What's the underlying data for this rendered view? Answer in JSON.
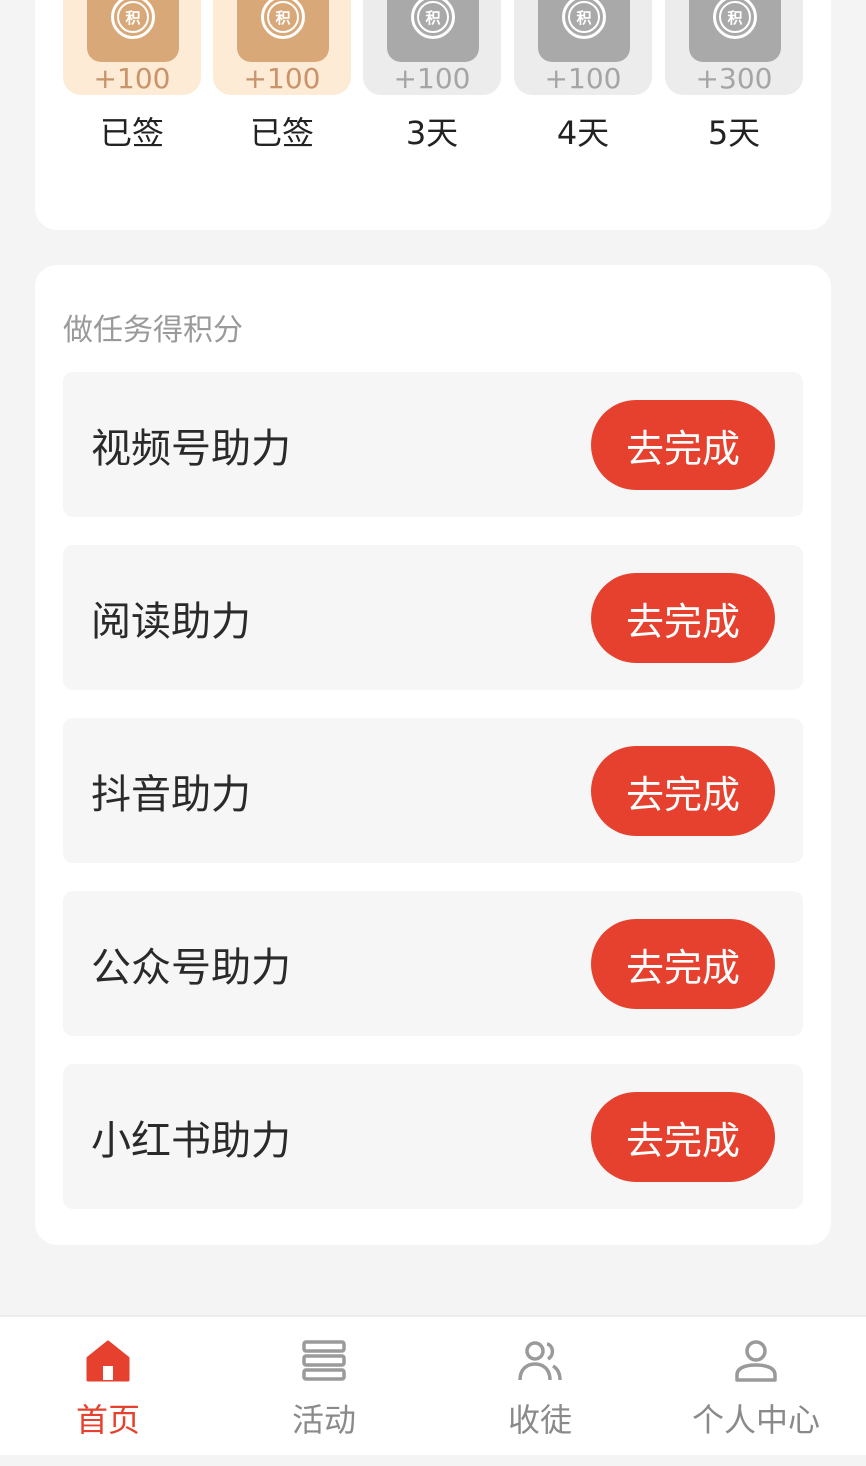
{
  "signin": {
    "days": [
      {
        "points": "+100",
        "label": "已签",
        "state": "signed",
        "badge": "积"
      },
      {
        "points": "+100",
        "label": "已签",
        "state": "signed",
        "badge": "积"
      },
      {
        "points": "+100",
        "label": "3天",
        "state": "pending",
        "badge": "积"
      },
      {
        "points": "+100",
        "label": "4天",
        "state": "pending",
        "badge": "积"
      },
      {
        "points": "+300",
        "label": "5天",
        "state": "pending",
        "badge": "积"
      }
    ]
  },
  "tasks": {
    "title": "做任务得积分",
    "items": [
      {
        "label": "视频号助力",
        "button": "去完成"
      },
      {
        "label": "阅读助力",
        "button": "去完成"
      },
      {
        "label": "抖音助力",
        "button": "去完成"
      },
      {
        "label": "公众号助力",
        "button": "去完成"
      },
      {
        "label": "小红书助力",
        "button": "去完成"
      }
    ]
  },
  "tabbar": {
    "items": [
      {
        "label": "首页",
        "icon": "home-icon",
        "active": true
      },
      {
        "label": "活动",
        "icon": "list-icon",
        "active": false
      },
      {
        "label": "收徒",
        "icon": "users-icon",
        "active": false
      },
      {
        "label": "个人中心",
        "icon": "user-icon",
        "active": false
      }
    ]
  },
  "colors": {
    "accent": "#e5412e",
    "signed_bg": "#fdebd5",
    "signed_coin": "#d9a878",
    "pending_bg": "#ececec",
    "pending_coin": "#a9a9a9"
  }
}
